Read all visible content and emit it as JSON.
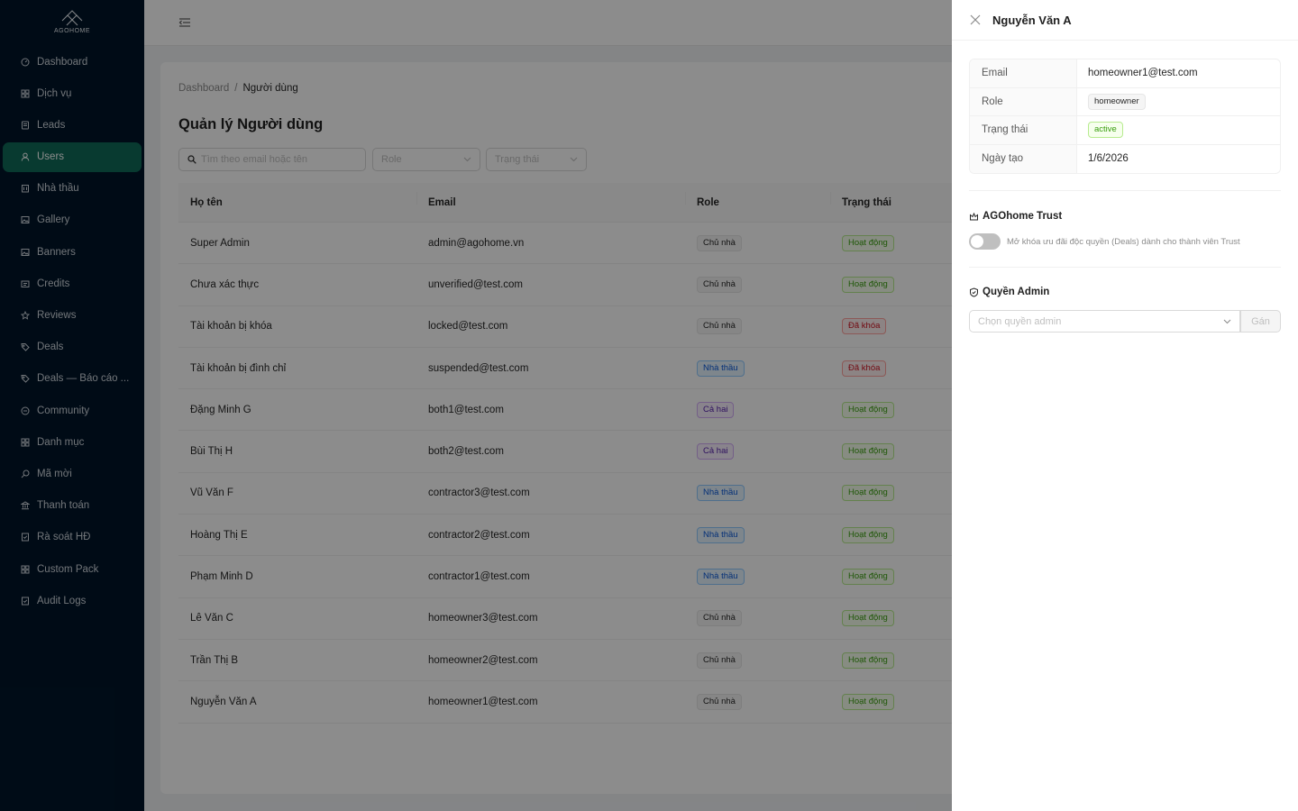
{
  "sidebar": {
    "logo_text": "AGOHOME",
    "items": [
      {
        "label": "Dashboard",
        "icon": "dashboard-icon"
      },
      {
        "label": "Dịch vụ",
        "icon": "grid-icon"
      },
      {
        "label": "Leads",
        "icon": "file-icon"
      },
      {
        "label": "Users",
        "icon": "user-icon",
        "active": true
      },
      {
        "label": "Nhà thầu",
        "icon": "building-icon"
      },
      {
        "label": "Gallery",
        "icon": "picture-icon"
      },
      {
        "label": "Banners",
        "icon": "picture-icon"
      },
      {
        "label": "Credits",
        "icon": "wallet-icon"
      },
      {
        "label": "Reviews",
        "icon": "star-icon"
      },
      {
        "label": "Deals",
        "icon": "tag-icon"
      },
      {
        "label": "Deals — Báo cáo ...",
        "icon": "tag-icon"
      },
      {
        "label": "Community",
        "icon": "chat-icon"
      },
      {
        "label": "Danh mục",
        "icon": "grid-icon"
      },
      {
        "label": "Mã mời",
        "icon": "search-icon"
      },
      {
        "label": "Thanh toán",
        "icon": "bank-icon"
      },
      {
        "label": "Rà soát HĐ",
        "icon": "audit-icon"
      },
      {
        "label": "Custom Pack",
        "icon": "grid-icon"
      },
      {
        "label": "Audit Logs",
        "icon": "audit-icon"
      }
    ]
  },
  "breadcrumb": {
    "root": "Dashboard",
    "sep": "/",
    "current": "Người dùng"
  },
  "page": {
    "title": "Quản lý Người dùng"
  },
  "filters": {
    "search_placeholder": "Tìm theo email hoặc tên",
    "role_placeholder": "Role",
    "status_placeholder": "Trạng thái"
  },
  "table": {
    "headers": {
      "name": "Họ tên",
      "email": "Email",
      "role": "Role",
      "status": "Trạng thái"
    },
    "rows": [
      {
        "name": "Super Admin",
        "email": "admin@agohome.vn",
        "role": "Chủ nhà",
        "role_style": "default",
        "status": "Hoạt động",
        "status_style": "green"
      },
      {
        "name": "Chưa xác thực",
        "email": "unverified@test.com",
        "role": "Chủ nhà",
        "role_style": "default",
        "status": "Hoạt động",
        "status_style": "green"
      },
      {
        "name": "Tài khoản bị khóa",
        "email": "locked@test.com",
        "role": "Chủ nhà",
        "role_style": "default",
        "status": "Đã khóa",
        "status_style": "red"
      },
      {
        "name": "Tài khoản bị đình chỉ",
        "email": "suspended@test.com",
        "role": "Nhà thầu",
        "role_style": "blue",
        "status": "Đã khóa",
        "status_style": "red"
      },
      {
        "name": "Đặng Minh G",
        "email": "both1@test.com",
        "role": "Cả hai",
        "role_style": "purple",
        "status": "Hoạt động",
        "status_style": "green"
      },
      {
        "name": "Bùi Thị H",
        "email": "both2@test.com",
        "role": "Cả hai",
        "role_style": "purple",
        "status": "Hoạt động",
        "status_style": "green"
      },
      {
        "name": "Vũ Văn F",
        "email": "contractor3@test.com",
        "role": "Nhà thầu",
        "role_style": "blue",
        "status": "Hoạt động",
        "status_style": "green"
      },
      {
        "name": "Hoàng Thị E",
        "email": "contractor2@test.com",
        "role": "Nhà thầu",
        "role_style": "blue",
        "status": "Hoạt động",
        "status_style": "green"
      },
      {
        "name": "Phạm Minh D",
        "email": "contractor1@test.com",
        "role": "Nhà thầu",
        "role_style": "blue",
        "status": "Hoạt động",
        "status_style": "green"
      },
      {
        "name": "Lê Văn C",
        "email": "homeowner3@test.com",
        "role": "Chủ nhà",
        "role_style": "default",
        "status": "Hoạt động",
        "status_style": "green"
      },
      {
        "name": "Trần Thị B",
        "email": "homeowner2@test.com",
        "role": "Chủ nhà",
        "role_style": "default",
        "status": "Hoạt động",
        "status_style": "green"
      },
      {
        "name": "Nguyễn Văn A",
        "email": "homeowner1@test.com",
        "role": "Chủ nhà",
        "role_style": "default",
        "status": "Hoạt động",
        "status_style": "green"
      }
    ]
  },
  "drawer": {
    "title": "Nguyễn Văn A",
    "details": [
      {
        "label": "Email",
        "value": "homeowner1@test.com",
        "type": "text"
      },
      {
        "label": "Role",
        "value": "homeowner",
        "type": "tag-default"
      },
      {
        "label": "Trạng thái",
        "value": "active",
        "type": "tag-green"
      },
      {
        "label": "Ngày tạo",
        "value": "1/6/2026",
        "type": "text"
      }
    ],
    "trust": {
      "title": "AGOhome Trust",
      "toggle_on": false,
      "description": "Mở khóa ưu đãi độc quyền (Deals) dành cho thành viên Trust"
    },
    "admin": {
      "title": "Quyền Admin",
      "select_placeholder": "Chọn quyền admin",
      "assign_label": "Gán"
    }
  },
  "colors": {
    "sidebar_bg": "#001529",
    "active_item": "#0f6b58",
    "mask": "rgba(0,0,0,0.45)"
  }
}
